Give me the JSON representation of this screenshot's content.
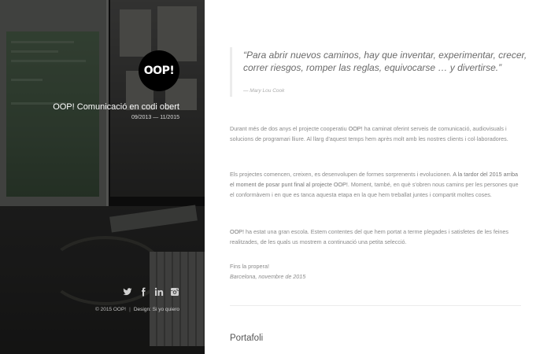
{
  "sidebar": {
    "logo_text": "OOP!",
    "title": "OOP! Comunicació en codi obert",
    "dates": "09/2013 — 11/2015",
    "social": [
      {
        "name": "twitter-icon"
      },
      {
        "name": "facebook-icon"
      },
      {
        "name": "linkedin-icon"
      },
      {
        "name": "instagram-icon"
      }
    ],
    "footer": {
      "copyright": "© 2015 OOP!",
      "separator": "|",
      "design": "Design: Si yo quiero"
    }
  },
  "content": {
    "quote": {
      "text": "“Para abrir nuevos caminos, hay que inventar, experimentar, crecer, correr riesgos, romper las reglas, equivocarse … y divertirse.”",
      "author": "— Mary Lou Cook"
    },
    "paragraphs": {
      "p1_a": "Durant més de dos anys el projecte cooperatiu ",
      "p1_b": "OOP!",
      "p1_c": " ha caminat oferint serveis de comunicació, audiovisuals i solucions de programari lliure. Al llarg d'aquest temps hem après molt amb les nostres clients i col·laboradores.",
      "p2_a": "Els projectes comencen, creixen, es desenvolupen de formes sorprenents i evolucionen. ",
      "p2_b": "A la tardor del 2015 arriba el moment de posar punt final al projecte OOP!",
      "p2_c": ". Moment, també, en què s'obren nous camins per les persones que el conformàvem i en que es tanca aquesta etapa en la que hem treballat juntes i compartit moltes coses.",
      "p3_a": "OOP!",
      "p3_b": " ha estat una gran escola. Estem contentes del que hem portat a terme plegades i satisfetes de les feines realitzades, de les quals us mostrem a continuació una petita selecció."
    },
    "sign_greeting": "Fins la propera!",
    "sign_place": "Barcelona, novembre de 2015",
    "portfolio_heading": "Portafoli"
  },
  "colors": {
    "sidebar_overlay": "#1c1c1c",
    "text_gray": "#8a8a8a",
    "heading_gray": "#555555"
  }
}
